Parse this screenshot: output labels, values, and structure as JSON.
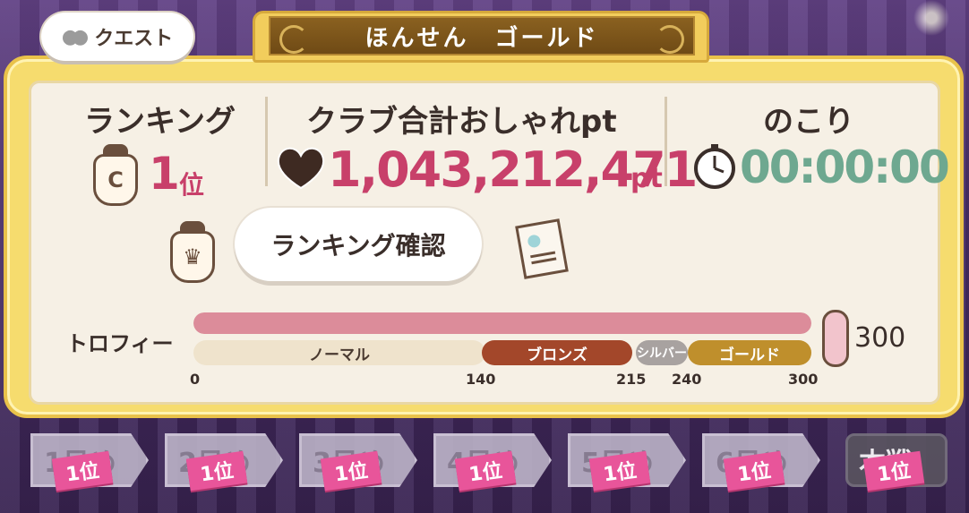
{
  "header": {
    "quest_button": "クエスト",
    "title": "ほんせん　ゴールド"
  },
  "ranking": {
    "label": "ランキング",
    "value": "1",
    "unit": "位"
  },
  "club_points": {
    "label": "クラブ合計おしゃれpt",
    "value": "1,043,212,471",
    "unit": "pt"
  },
  "remaining": {
    "label": "のこり",
    "value": "00:00:00"
  },
  "ranking_check_button": "ランキング確認",
  "trophy": {
    "label": "トロフィー",
    "current": 300,
    "max_label": "300",
    "progress_fraction": 1.0,
    "tiers": [
      {
        "name": "ノーマル"
      },
      {
        "name": "ブロンズ"
      },
      {
        "name": "シルバー"
      },
      {
        "name": "ゴールド"
      }
    ],
    "ticks": [
      "0",
      "140",
      "215",
      "240",
      "300"
    ]
  },
  "days": [
    {
      "label": "1日め",
      "rank": "1位"
    },
    {
      "label": "2日め",
      "rank": "1位"
    },
    {
      "label": "3日め",
      "rank": "1位"
    },
    {
      "label": "4日め",
      "rank": "1位"
    },
    {
      "label": "5日め",
      "rank": "1位"
    },
    {
      "label": "6日め",
      "rank": "1位"
    },
    {
      "label": "本戦",
      "rank": "1位"
    }
  ],
  "colors": {
    "pink_value": "#c8406a",
    "timer_green": "#6ea890",
    "gold_frame": "#f6dc6e",
    "badge_pink": "#e8559a"
  }
}
